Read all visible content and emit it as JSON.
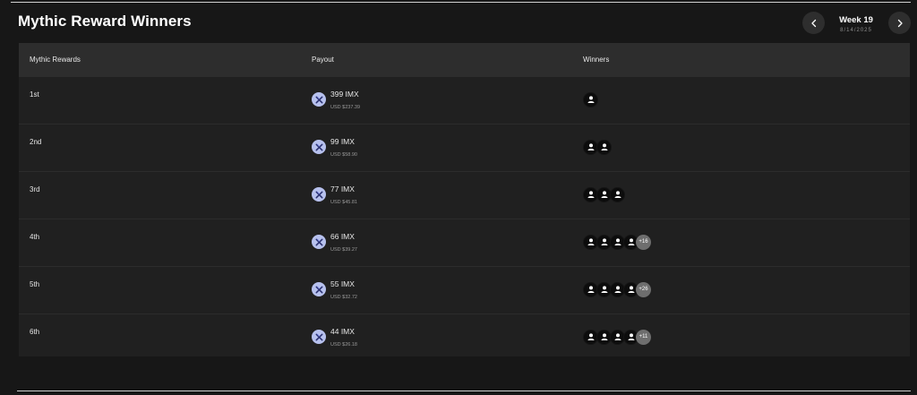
{
  "header": {
    "title": "Mythic Reward Winners",
    "week_label": "Week 19",
    "week_date": "8/14/2025",
    "prev_icon": "chevron-left-icon",
    "next_icon": "chevron-right-icon"
  },
  "table": {
    "columns": [
      "Mythic Rewards",
      "Payout",
      "Winners"
    ],
    "rows": [
      {
        "rank": "1st",
        "amount": "399 IMX",
        "usd": "USD $237.39",
        "avatars": 1,
        "more": ""
      },
      {
        "rank": "2nd",
        "amount": "99 IMX",
        "usd": "USD $58.90",
        "avatars": 2,
        "more": ""
      },
      {
        "rank": "3rd",
        "amount": "77 IMX",
        "usd": "USD $45.81",
        "avatars": 3,
        "more": ""
      },
      {
        "rank": "4th",
        "amount": "66 IMX",
        "usd": "USD $39.27",
        "avatars": 4,
        "more": "+16"
      },
      {
        "rank": "5th",
        "amount": "55 IMX",
        "usd": "USD $32.72",
        "avatars": 4,
        "more": "+26"
      },
      {
        "rank": "6th",
        "amount": "44 IMX",
        "usd": "USD $26.18",
        "avatars": 4,
        "more": "+11"
      }
    ],
    "coin_icon": "imx-token-icon",
    "avatar_icon": "user-avatar-icon"
  },
  "colors": {
    "background": "#171717",
    "table_bg": "#202020",
    "header_bg": "#2d2d2d",
    "coin": "#b7c1ee",
    "more_badge": "#6e6e6e"
  }
}
